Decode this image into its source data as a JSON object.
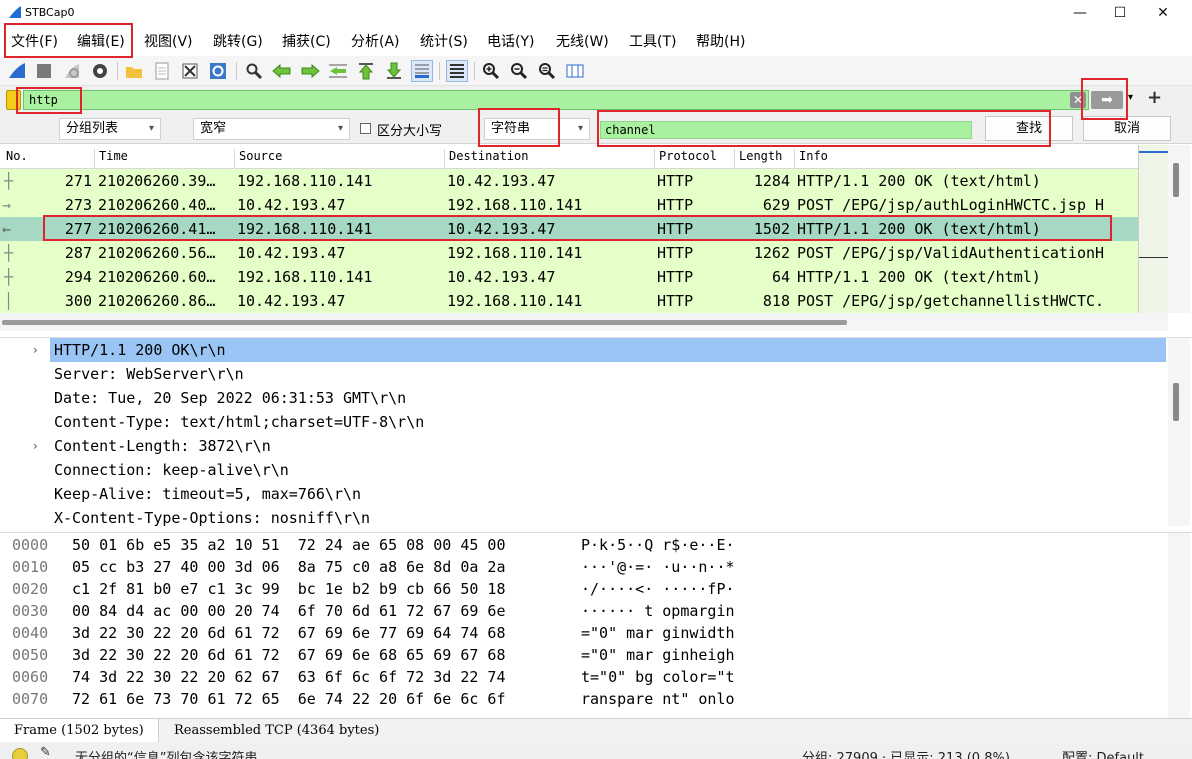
{
  "window": {
    "title": "STBCap0",
    "minimize": "—",
    "maximize": "☐",
    "close": "✕"
  },
  "menu": [
    "文件(F)",
    "编辑(E)",
    "视图(V)",
    "跳转(G)",
    "捕获(C)",
    "分析(A)",
    "统计(S)",
    "电话(Y)",
    "无线(W)",
    "工具(T)",
    "帮助(H)"
  ],
  "toolbar": {
    "icons": [
      "shark-fin-icon",
      "stop-icon",
      "restart-icon",
      "options-gear-icon",
      "open-folder-icon",
      "save-file-icon",
      "close-file-icon",
      "reload-icon",
      "find-packet-icon",
      "go-back-icon",
      "go-forward-icon",
      "go-to-packet-icon",
      "first-packet-icon",
      "last-packet-icon",
      "auto-scroll-icon",
      "colorize-icon",
      "zoom-in-icon",
      "zoom-out-icon",
      "normal-size-icon",
      "resize-columns-icon"
    ]
  },
  "filter": {
    "value": "http",
    "clear": "✕",
    "apply": "➡",
    "dropdown": "▾",
    "add": "+"
  },
  "find": {
    "scope": "分组列表",
    "charset": "宽窄",
    "case_label": "区分大小写",
    "type": "字符串",
    "value": "channel",
    "find_label": "查找",
    "cancel_label": "取消"
  },
  "packet_list": {
    "columns": [
      "No.",
      "Time",
      "Source",
      "Destination",
      "Protocol",
      "Length",
      "Info"
    ],
    "rows": [
      {
        "no": "271",
        "time": "210206260.39…",
        "src": "192.168.110.141",
        "dst": "10.42.193.47",
        "proto": "HTTP",
        "len": "1284",
        "info": "HTTP/1.1 200 OK  (text/html)"
      },
      {
        "no": "273",
        "time": "210206260.40…",
        "src": "10.42.193.47",
        "dst": "192.168.110.141",
        "proto": "HTTP",
        "len": "629",
        "info": "POST /EPG/jsp/authLoginHWCTC.jsp H"
      },
      {
        "no": "277",
        "time": "210206260.41…",
        "src": "192.168.110.141",
        "dst": "10.42.193.47",
        "proto": "HTTP",
        "len": "1502",
        "info": "HTTP/1.1 200 OK  (text/html)"
      },
      {
        "no": "287",
        "time": "210206260.56…",
        "src": "10.42.193.47",
        "dst": "192.168.110.141",
        "proto": "HTTP",
        "len": "1262",
        "info": "POST /EPG/jsp/ValidAuthenticationH"
      },
      {
        "no": "294",
        "time": "210206260.60…",
        "src": "192.168.110.141",
        "dst": "10.42.193.47",
        "proto": "HTTP",
        "len": "64",
        "info": "HTTP/1.1 200 OK  (text/html)"
      },
      {
        "no": "300",
        "time": "210206260.86…",
        "src": "10.42.193.47",
        "dst": "192.168.110.141",
        "proto": "HTTP",
        "len": "818",
        "info": "POST /EPG/jsp/getchannellistHWCTC."
      }
    ]
  },
  "detail": {
    "lines": [
      "HTTP/1.1 200 OK\\r\\n",
      "Server: WebServer\\r\\n",
      "Date: Tue, 20 Sep 2022 06:31:53 GMT\\r\\n",
      "Content-Type: text/html;charset=UTF-8\\r\\n",
      "Content-Length: 3872\\r\\n",
      "Connection: keep-alive\\r\\n",
      "Keep-Alive: timeout=5, max=766\\r\\n",
      "X-Content-Type-Options: nosniff\\r\\n"
    ],
    "expander": "›"
  },
  "hex": {
    "rows": [
      {
        "off": "0000",
        "bytes": "50 01 6b e5 35 a2 10 51  72 24 ae 65 08 00 45 00",
        "ascii": "P·k·5··Q r$·e··E·"
      },
      {
        "off": "0010",
        "bytes": "05 cc b3 27 40 00 3d 06  8a 75 c0 a8 6e 8d 0a 2a",
        "ascii": "···'@·=· ·u··n··*"
      },
      {
        "off": "0020",
        "bytes": "c1 2f 81 b0 e7 c1 3c 99  bc 1e b2 b9 cb 66 50 18",
        "ascii": "·/····<· ·····fP·"
      },
      {
        "off": "0030",
        "bytes": "00 84 d4 ac 00 00 20 74  6f 70 6d 61 72 67 69 6e",
        "ascii": "······ t opmargin"
      },
      {
        "off": "0040",
        "bytes": "3d 22 30 22 20 6d 61 72  67 69 6e 77 69 64 74 68",
        "ascii": "=\"0\" mar ginwidth"
      },
      {
        "off": "0050",
        "bytes": "3d 22 30 22 20 6d 61 72  67 69 6e 68 65 69 67 68",
        "ascii": "=\"0\" mar ginheigh"
      },
      {
        "off": "0060",
        "bytes": "74 3d 22 30 22 20 62 67  63 6f 6c 6f 72 3d 22 74",
        "ascii": "t=\"0\" bg color=\"t"
      },
      {
        "off": "0070",
        "bytes": "72 61 6e 73 70 61 72 65  6e 74 22 20 6f 6e 6c 6f",
        "ascii": "ranspare nt\" onlo"
      }
    ]
  },
  "byte_tabs": [
    "Frame (1502 bytes)",
    "Reassembled TCP (4364 bytes)"
  ],
  "status": {
    "message": "无分组的“信息”列包含该字符串",
    "counts": "分组: 27909 · 已显示: 213 (0.8%)",
    "profile": "配置: Default"
  },
  "colors": {
    "row_bg": "#e4ffc7",
    "row_selected": "#a5d9c3",
    "filter_bg": "#a9f0a0",
    "detail_selected": "#99c4f4",
    "highlight": "#e0242c"
  }
}
